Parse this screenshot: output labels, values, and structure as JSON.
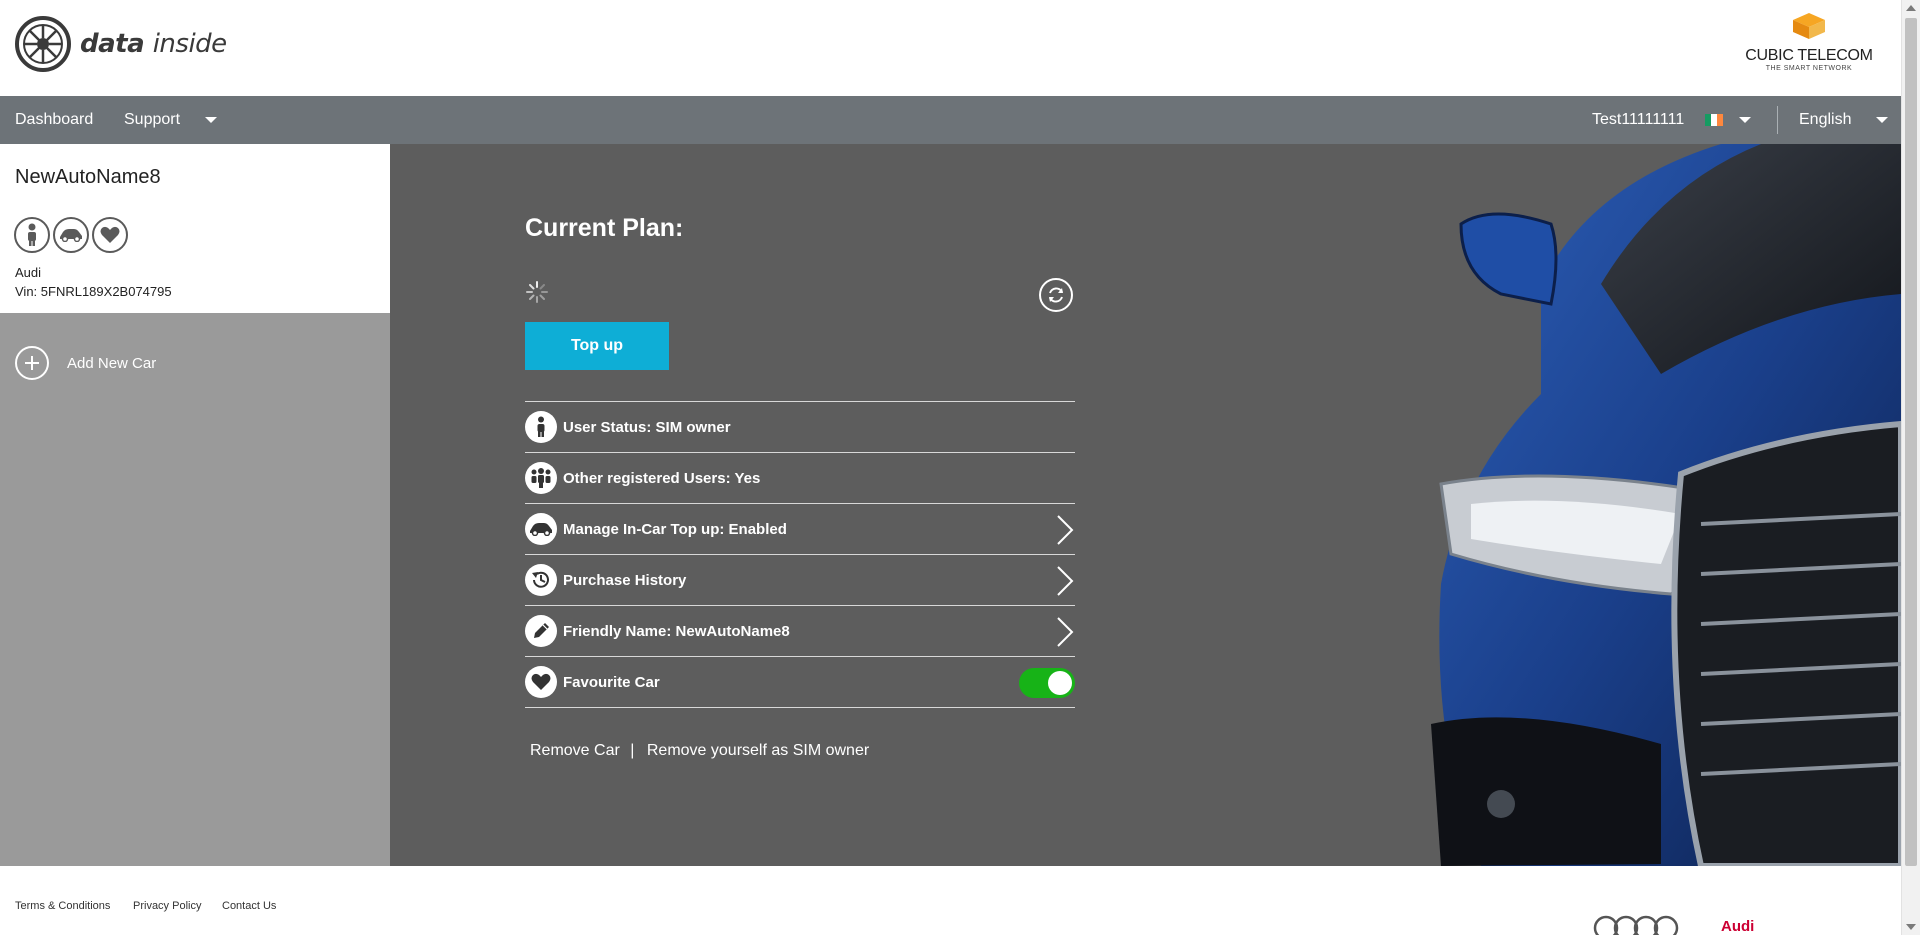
{
  "header": {
    "logo_text_bold": "data",
    "logo_text_rest": "inside",
    "partner_name": "CUBIC TELECOM",
    "partner_tagline": "THE SMART NETWORK"
  },
  "nav": {
    "dashboard": "Dashboard",
    "support": "Support",
    "user": "Test11111111",
    "language": "English"
  },
  "sidebar": {
    "car_name": "NewAutoName8",
    "make": "Audi",
    "vin": "Vin: 5FNRL189X2B074795",
    "add_new_car": "Add New Car"
  },
  "main": {
    "plan_title": "Current Plan:",
    "topup_label": "Top up",
    "rows": [
      {
        "label": "User Status: SIM owner",
        "icon": "person-icon"
      },
      {
        "label": "Other registered Users: Yes",
        "icon": "group-icon"
      },
      {
        "label": "Manage In-Car Top up: Enabled",
        "icon": "car-icon"
      },
      {
        "label": "Purchase History",
        "icon": "history-icon"
      },
      {
        "label": "Friendly Name: NewAutoName8",
        "icon": "pencil-icon"
      },
      {
        "label": "Favourite Car",
        "icon": "heart-icon"
      }
    ],
    "favourite_enabled": true,
    "remove_car": "Remove Car",
    "separator": "|",
    "remove_sim_owner": "Remove yourself as SIM owner"
  },
  "footer": {
    "terms": "Terms & Conditions",
    "privacy": "Privacy Policy",
    "contact": "Contact Us",
    "brand": "Audi"
  },
  "colors": {
    "nav_bg": "#6d7378",
    "main_bg": "#5d5d5d",
    "sidebar_bg": "#9a9a9a",
    "accent": "#0eaed6",
    "toggle_on": "#17b317",
    "brand_red": "#cc0033"
  }
}
